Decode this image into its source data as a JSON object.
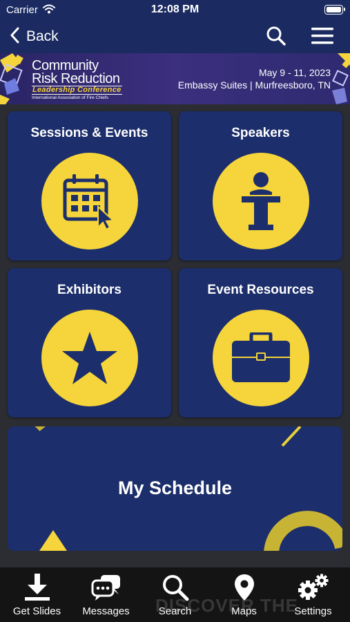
{
  "status_bar": {
    "carrier": "Carrier",
    "time": "12:08 PM"
  },
  "nav": {
    "back_label": "Back",
    "icons": [
      "chevron-left-icon",
      "search-icon",
      "hamburger-menu-icon"
    ]
  },
  "banner": {
    "title_line1": "Community",
    "title_line2": "Risk Reduction",
    "subtitle": "Leadership Conference",
    "organization": "International Association of Fire Chiefs",
    "date": "May 9 - 11, 2023",
    "venue": "Embassy Suites | Murfreesboro, TN"
  },
  "tiles": [
    {
      "label": "Sessions & Events",
      "icon": "calendar-icon"
    },
    {
      "label": "Speakers",
      "icon": "podium-icon"
    },
    {
      "label": "Exhibitors",
      "icon": "star-icon"
    },
    {
      "label": "Event Resources",
      "icon": "briefcase-icon"
    }
  ],
  "schedule": {
    "label": "My Schedule"
  },
  "tab_bar": {
    "background_text": "DISCOVER THE",
    "items": [
      {
        "label": "Get Slides",
        "icon": "download-icon"
      },
      {
        "label": "Messages",
        "icon": "chat-bubbles-icon"
      },
      {
        "label": "Search",
        "icon": "search-icon"
      },
      {
        "label": "Maps",
        "icon": "map-pin-icon"
      },
      {
        "label": "Settings",
        "icon": "gears-icon"
      }
    ]
  },
  "colors": {
    "nav_background": "#1b2b62",
    "tile_background": "#1c2e6b",
    "accent_yellow": "#f5d53b",
    "tab_bar_background": "#141414"
  }
}
